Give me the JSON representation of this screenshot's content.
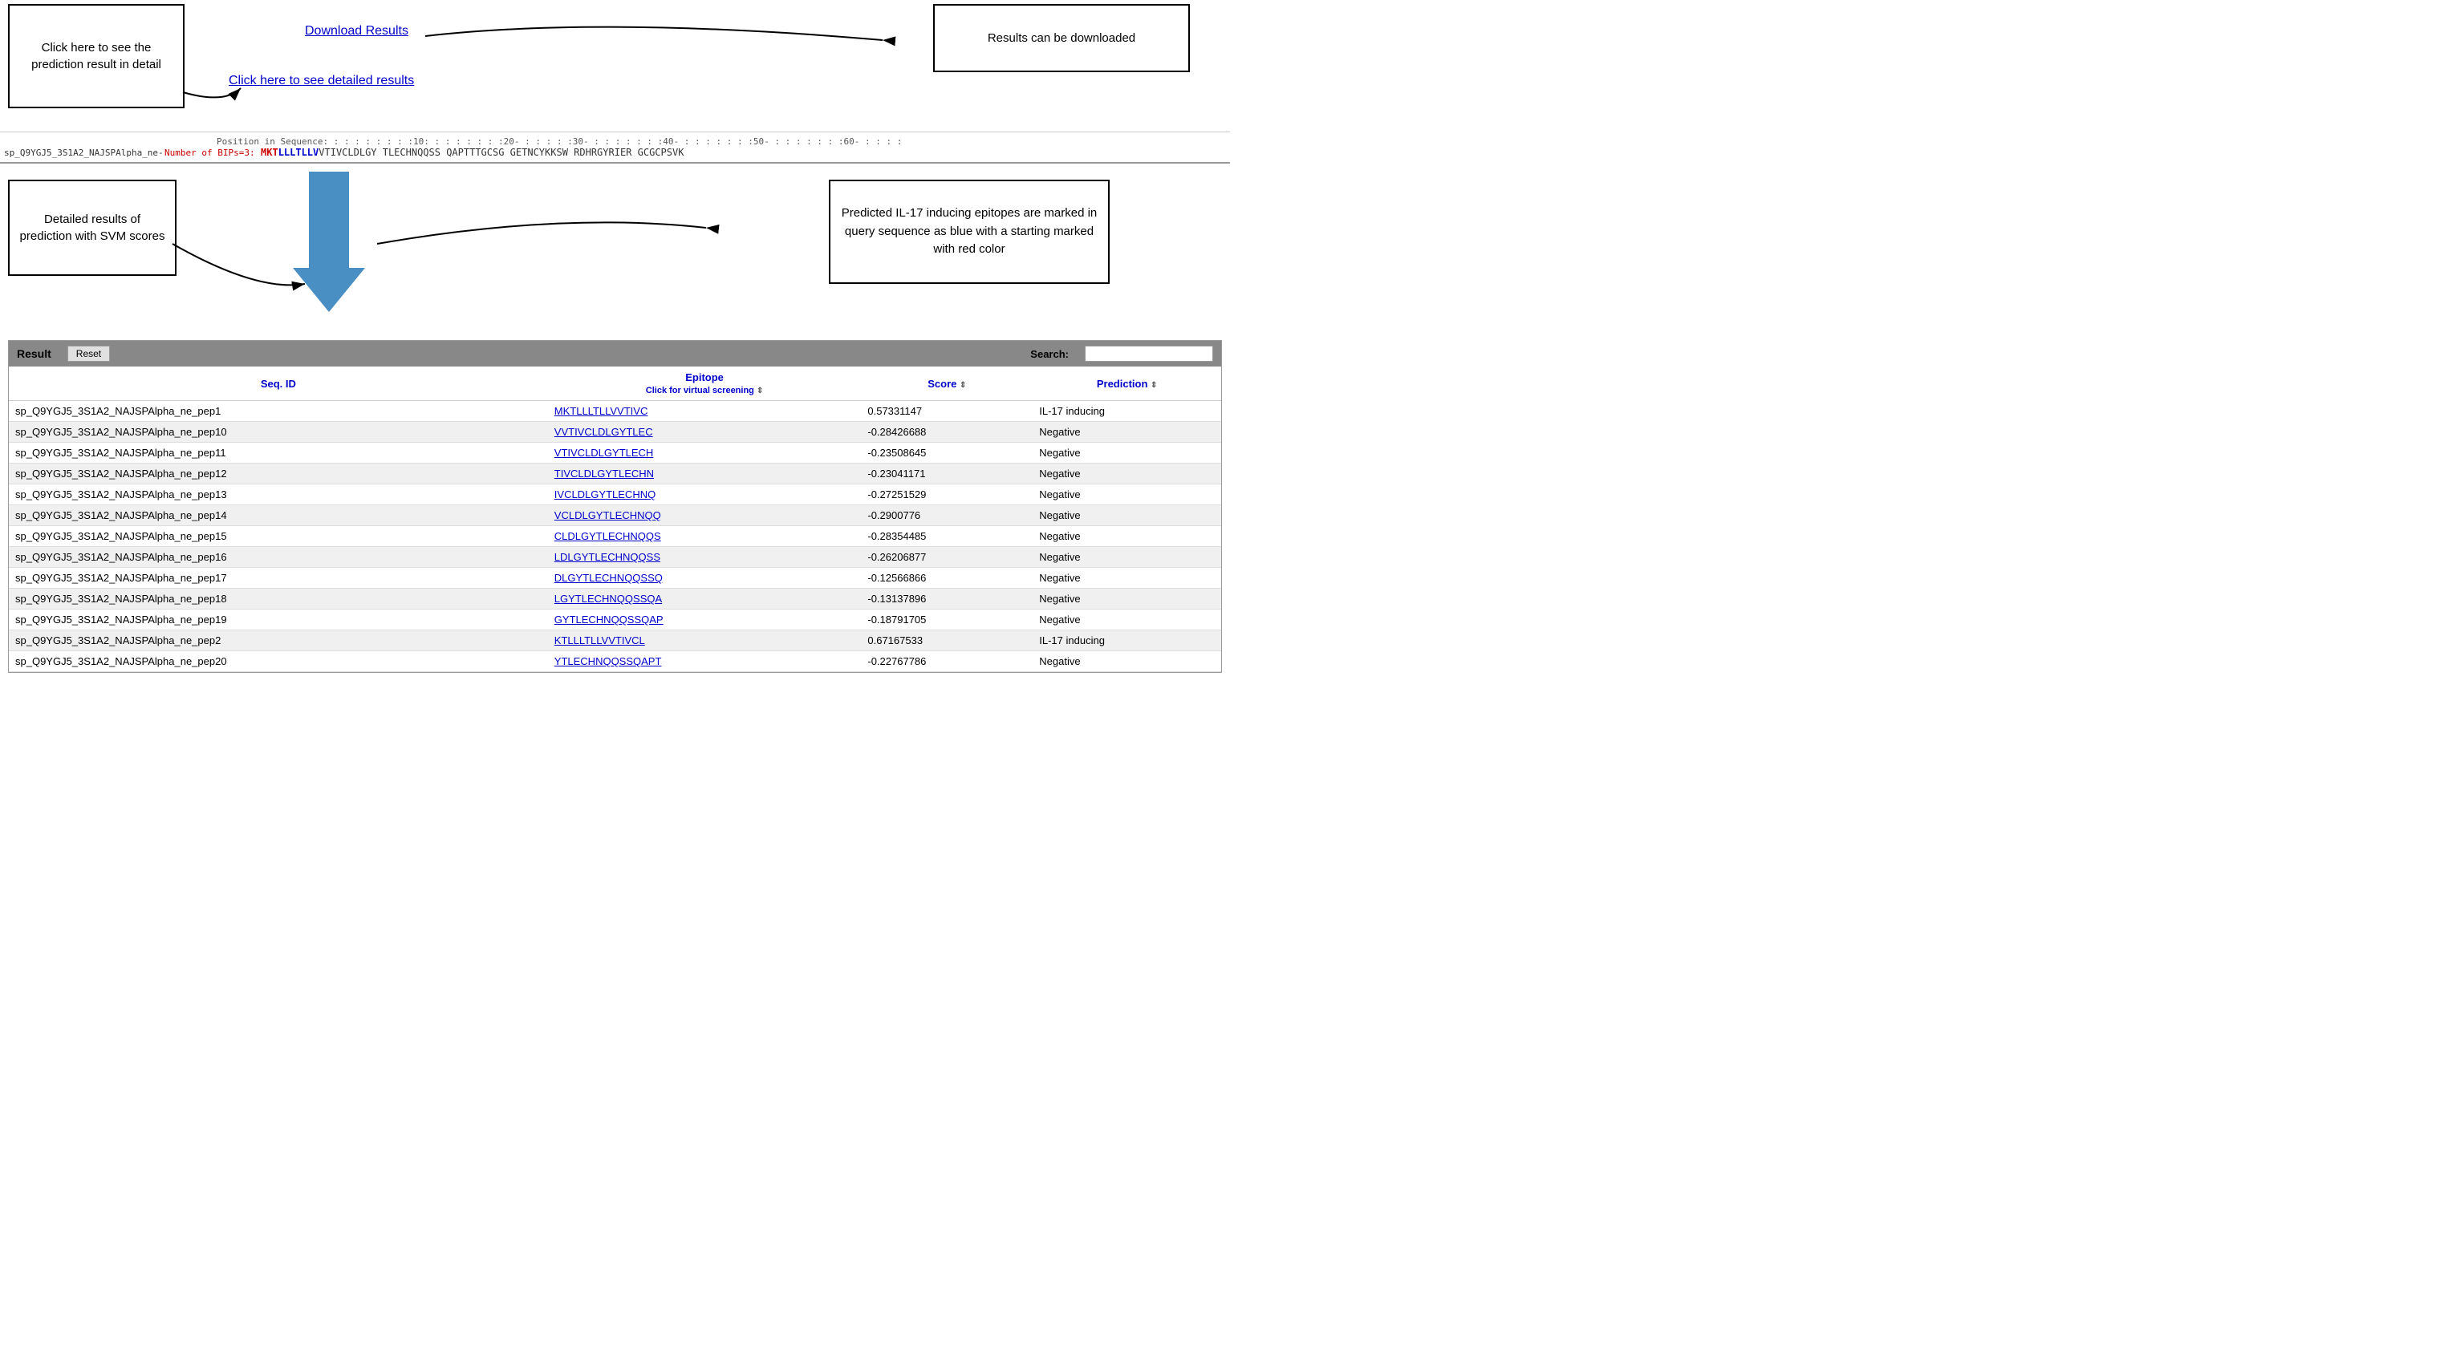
{
  "top": {
    "callout_left": "Click here to see the prediction result in detail",
    "callout_right": "Results can be downloaded",
    "download_link": "Download Results",
    "detailed_link": "Click here to see detailed results"
  },
  "sequence": {
    "ruler": "Position in Sequence:  :  :  :  :  :  :  :  :10:  :  :  :  :  :  :  :20-  :  :  :  :  :30-  :  :  :  :  :  :  :40-  :  :  :  :  :  :  :50-  :  :  :  :  :  :  :60-  :  :  :  :",
    "id_label": "sp_Q9YGJ5_3S1A2_NAJSPAlpha_ne-",
    "bips_label": "Number of BIPs=3:",
    "residues_red": "MKT",
    "residues_blue": "LLLTLLV",
    "residues_after": " VTIVCLDLGY TLECHNQQSS QAPTTTGCSG GETNCYKKSW RDHRGYRIER GCGCPSVK"
  },
  "middle": {
    "callout_left": "Detailed results of prediction with SVM scores",
    "callout_right": "Predicted IL-17 inducing epitopes are marked in query sequence as blue  with a starting marked with red color"
  },
  "table": {
    "header": "Result",
    "reset_btn": "Reset",
    "search_label": "Search:",
    "search_placeholder": "",
    "columns": [
      {
        "id": "seq_id",
        "label": "Seq. ID"
      },
      {
        "id": "epitope",
        "label": "Epitope\nClick for virtual screening"
      },
      {
        "id": "score",
        "label": "Score"
      },
      {
        "id": "prediction",
        "label": "Prediction"
      }
    ],
    "rows": [
      {
        "seq_id": "sp_Q9YGJ5_3S1A2_NAJSPAlpha_ne_pep1",
        "epitope": "MKTLLLTLLVVTIVC",
        "score": "0.57331147",
        "prediction": "IL-17 inducing"
      },
      {
        "seq_id": "sp_Q9YGJ5_3S1A2_NAJSPAlpha_ne_pep10",
        "epitope": "VVTIVCLDLGYTLEC",
        "score": "-0.28426688",
        "prediction": "Negative"
      },
      {
        "seq_id": "sp_Q9YGJ5_3S1A2_NAJSPAlpha_ne_pep11",
        "epitope": "VTIVCLDLGYTLECH",
        "score": "-0.23508645",
        "prediction": "Negative"
      },
      {
        "seq_id": "sp_Q9YGJ5_3S1A2_NAJSPAlpha_ne_pep12",
        "epitope": "TIVCLDLGYTLECHN",
        "score": "-0.23041171",
        "prediction": "Negative"
      },
      {
        "seq_id": "sp_Q9YGJ5_3S1A2_NAJSPAlpha_ne_pep13",
        "epitope": "IVCLDLGYTLECHNQ",
        "score": "-0.27251529",
        "prediction": "Negative"
      },
      {
        "seq_id": "sp_Q9YGJ5_3S1A2_NAJSPAlpha_ne_pep14",
        "epitope": "VCLDLGYTLECHNQQ",
        "score": "-0.2900776",
        "prediction": "Negative"
      },
      {
        "seq_id": "sp_Q9YGJ5_3S1A2_NAJSPAlpha_ne_pep15",
        "epitope": "CLDLGYTLECHNQQS",
        "score": "-0.28354485",
        "prediction": "Negative"
      },
      {
        "seq_id": "sp_Q9YGJ5_3S1A2_NAJSPAlpha_ne_pep16",
        "epitope": "LDLGYTLECHNQQSS",
        "score": "-0.26206877",
        "prediction": "Negative"
      },
      {
        "seq_id": "sp_Q9YGJ5_3S1A2_NAJSPAlpha_ne_pep17",
        "epitope": "DLGYTLECHNQQSSQ",
        "score": "-0.12566866",
        "prediction": "Negative"
      },
      {
        "seq_id": "sp_Q9YGJ5_3S1A2_NAJSPAlpha_ne_pep18",
        "epitope": "LGYTLECHNQQSSQA",
        "score": "-0.13137896",
        "prediction": "Negative"
      },
      {
        "seq_id": "sp_Q9YGJ5_3S1A2_NAJSPAlpha_ne_pep19",
        "epitope": "GYTLECHNQQSSQAP",
        "score": "-0.18791705",
        "prediction": "Negative"
      },
      {
        "seq_id": "sp_Q9YGJ5_3S1A2_NAJSPAlpha_ne_pep2",
        "epitope": "KTLLLTLLVVTIVCL",
        "score": "0.67167533",
        "prediction": "IL-17 inducing"
      },
      {
        "seq_id": "sp_Q9YGJ5_3S1A2_NAJSPAlpha_ne_pep20",
        "epitope": "YTLECHNQQSSQAPT",
        "score": "-0.22767786",
        "prediction": "Negative"
      }
    ]
  }
}
